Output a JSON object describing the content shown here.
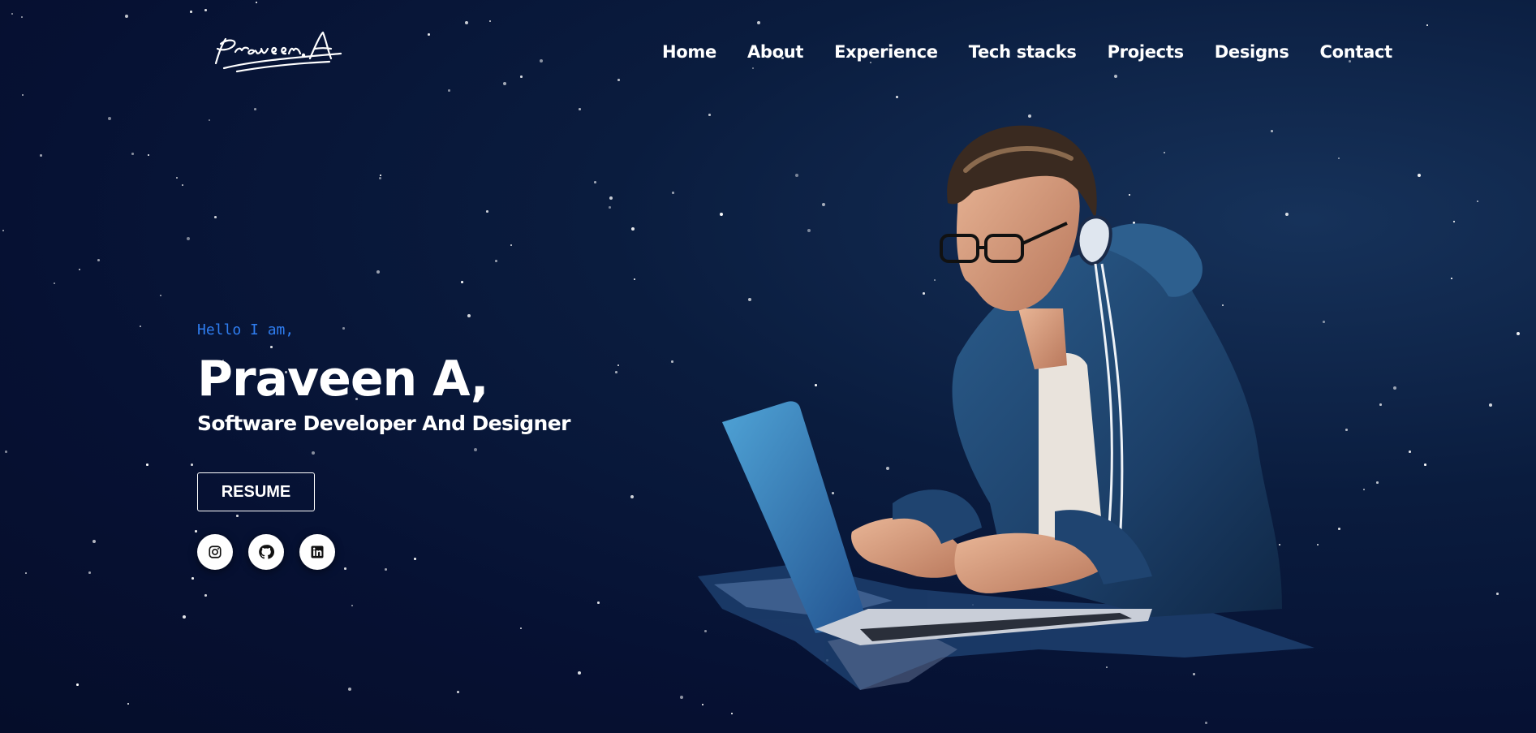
{
  "logo": {
    "text": "Praveen A"
  },
  "nav": {
    "items": [
      {
        "label": "Home"
      },
      {
        "label": "About"
      },
      {
        "label": "Experience"
      },
      {
        "label": "Tech stacks"
      },
      {
        "label": "Projects"
      },
      {
        "label": "Designs"
      },
      {
        "label": "Contact"
      }
    ]
  },
  "hero": {
    "greeting": "Hello I am,",
    "name": "Praveen A,",
    "role": "Software Developer And Designer",
    "resume_label": "RESUME"
  },
  "socials": [
    {
      "icon": "instagram-icon"
    },
    {
      "icon": "github-icon"
    },
    {
      "icon": "linkedin-icon"
    }
  ],
  "colors": {
    "background": "#061133",
    "accent": "#2f7df0",
    "text": "#ffffff"
  }
}
